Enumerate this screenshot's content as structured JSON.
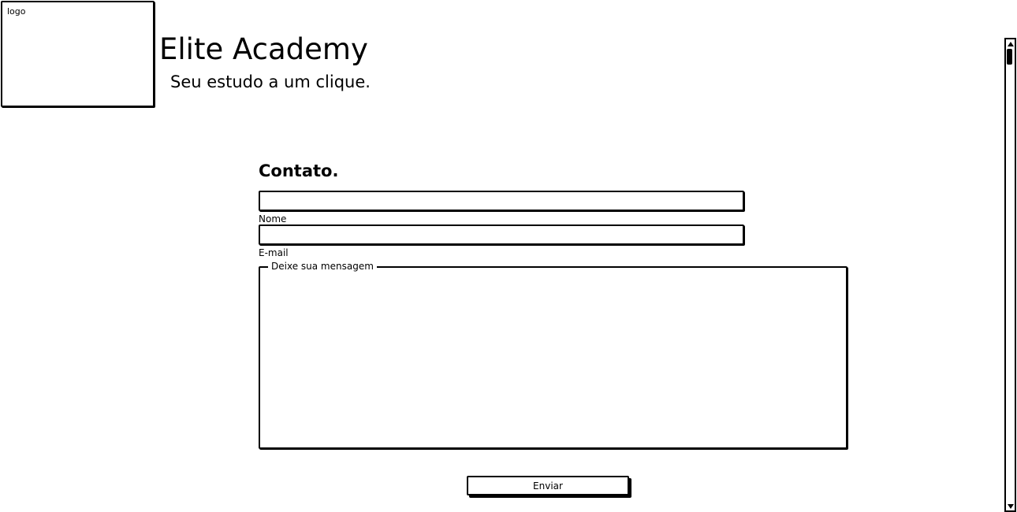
{
  "header": {
    "logo_label": "logo",
    "title": "Elite Academy",
    "subtitle": "Seu estudo a um clique."
  },
  "contact": {
    "heading": "Contato.",
    "name_field": {
      "label": "Nome",
      "value": ""
    },
    "email_field": {
      "label": "E-mail",
      "value": ""
    },
    "message_field": {
      "label": "Deixe sua mensagem",
      "value": ""
    },
    "submit_label": "Enviar"
  },
  "scrollbar": {
    "up_icon": "arrow-up-icon",
    "down_icon": "arrow-down-icon"
  }
}
